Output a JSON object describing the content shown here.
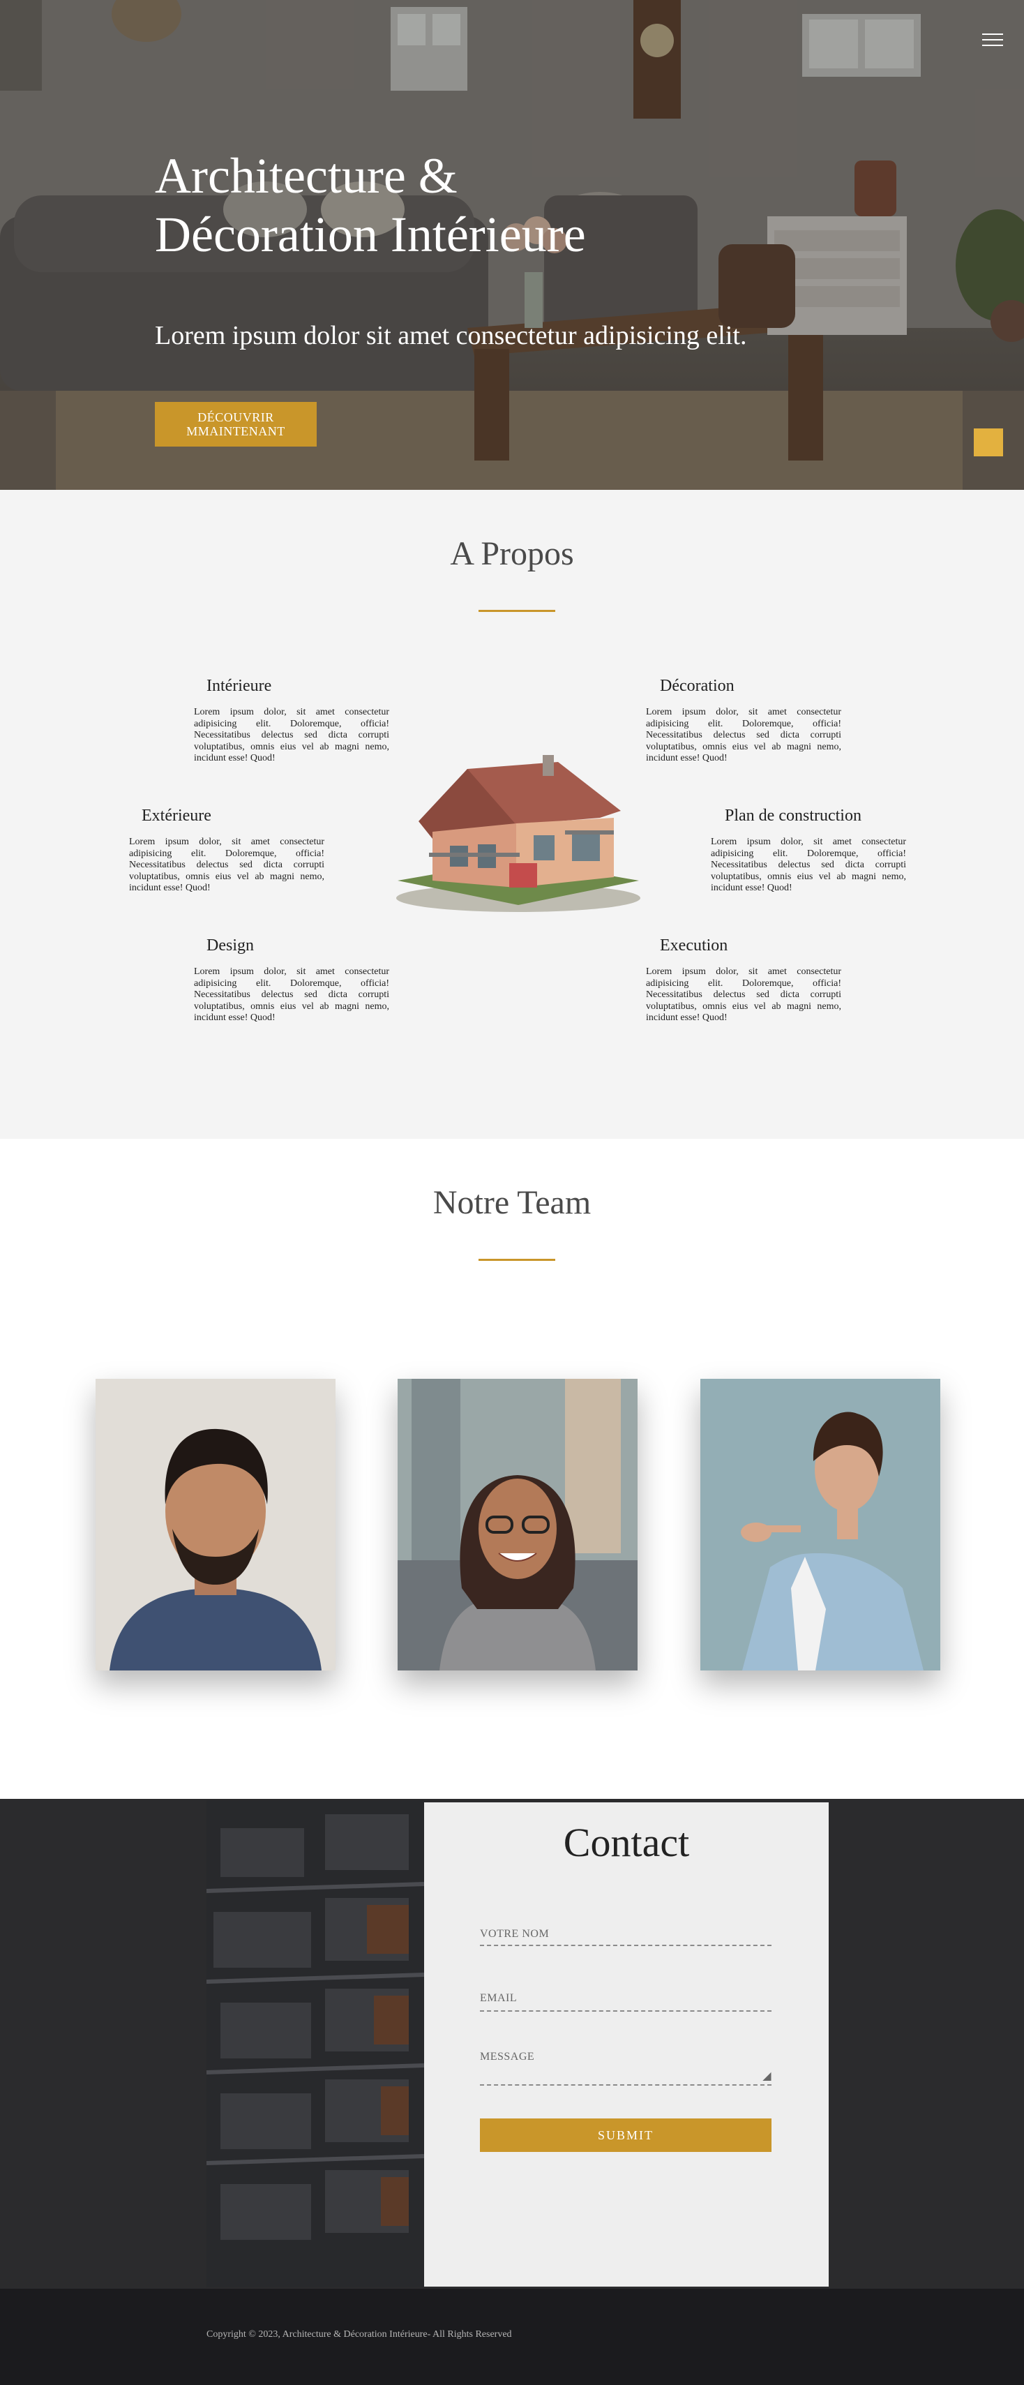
{
  "hero": {
    "title": "Architecture & Décoration Intérieure",
    "subtitle": "Lorem ipsum dolor sit amet consectetur adipisicing elit.",
    "cta_label": "DÉCOUVRIR MMAINTENANT",
    "menu_icon": "hamburger-menu-icon"
  },
  "about": {
    "title": "A Propos",
    "features": [
      {
        "title": "Intérieure",
        "text": "Lorem ipsum dolor, sit amet consectetur adipisicing elit. Doloremque, officia! Necessitatibus delectus sed dicta corrupti voluptatibus, omnis eius vel ab magni nemo, incidunt esse! Quod!"
      },
      {
        "title": "Décoration",
        "text": "Lorem ipsum dolor, sit amet consectetur adipisicing elit. Doloremque, officia! Necessitatibus delectus sed dicta corrupti voluptatibus, omnis eius vel ab magni nemo, incidunt esse! Quod!"
      },
      {
        "title": "Extérieure",
        "text": "Lorem ipsum dolor, sit amet consectetur adipisicing elit. Doloremque, officia! Necessitatibus delectus sed dicta corrupti voluptatibus, omnis eius vel ab magni nemo, incidunt esse! Quod!"
      },
      {
        "title": "Plan de construction",
        "text": "Lorem ipsum dolor, sit amet consectetur adipisicing elit. Doloremque, officia! Necessitatibus delectus sed dicta corrupti voluptatibus, omnis eius vel ab magni nemo, incidunt esse! Quod!"
      },
      {
        "title": "Design",
        "text": "Lorem ipsum dolor, sit amet consectetur adipisicing elit. Doloremque, officia! Necessitatibus delectus sed dicta corrupti voluptatibus, omnis eius vel ab magni nemo, incidunt esse! Quod!"
      },
      {
        "title": "Execution",
        "text": "Lorem ipsum dolor, sit amet consectetur adipisicing elit. Doloremque, officia! Necessitatibus delectus sed dicta corrupti voluptatibus, omnis eius vel ab magni nemo, incidunt esse! Quod!"
      }
    ]
  },
  "team": {
    "title": "Notre Team"
  },
  "contact": {
    "title": "Contact",
    "name_placeholder": "VOTRE NOM",
    "email_placeholder": "EMAIL",
    "message_placeholder": "MESSAGE",
    "submit_label": "SUBMIT"
  },
  "footer": {
    "copyright": "Copyright © 2023, Architecture & Décoration Intérieure- All Rights Reserved"
  },
  "colors": {
    "accent": "#c9962a",
    "about_bg": "#f4f4f4",
    "contact_band": "#2b2b2d",
    "footer_bg": "#1b1b1e"
  }
}
